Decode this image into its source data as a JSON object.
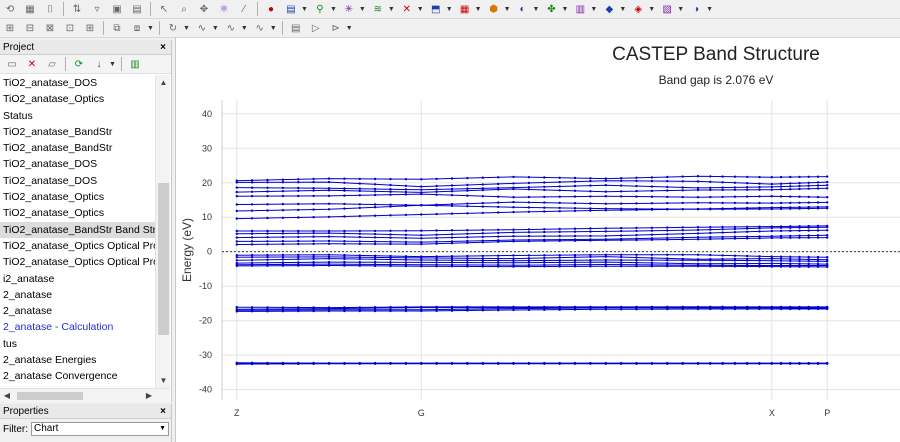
{
  "toolbar1": {
    "icons": [
      "refresh-icon",
      "grid-icon",
      "bracket-icon",
      "sort-icon",
      "funnel-icon",
      "window-icon",
      "window-icon-2",
      "select-icon",
      "zoom-icon",
      "move-icon",
      "atom-icon",
      "bond-icon",
      "record-icon",
      "castep-icon",
      "dmol-icon",
      "gulp-icon",
      "forcite-icon",
      "mesocite-icon",
      "amorphous-icon",
      "sorption-icon",
      "conformers-icon",
      "reflex-icon",
      "morphology-icon",
      "polymorph-icon",
      "dpd-icon",
      "blends-icon",
      "qsar-icon",
      "equilibria-icon"
    ]
  },
  "toolbar2": {
    "icons": [
      "grid-a-icon",
      "grid-b-icon",
      "grid-c-icon",
      "grid-d-icon",
      "grid-e-icon",
      "layer-icon",
      "format-icon",
      "rotate-icon",
      "curve-a-icon",
      "curve-b-icon",
      "curve-c-icon",
      "doc-icon",
      "play-icon",
      "step-icon"
    ]
  },
  "project": {
    "title": "Project",
    "close": "×",
    "items": [
      {
        "label": "TiO2_anatase_DOS",
        "style": "normal"
      },
      {
        "label": "TiO2_anatase_Optics",
        "style": "normal"
      },
      {
        "label": "Status",
        "style": "normal"
      },
      {
        "label": "TiO2_anatase_BandStr",
        "style": "normal"
      },
      {
        "label": "TiO2_anatase_BandStr",
        "style": "normal"
      },
      {
        "label": "TiO2_anatase_DOS",
        "style": "normal"
      },
      {
        "label": "TiO2_anatase_DOS",
        "style": "normal"
      },
      {
        "label": "TiO2_anatase_Optics",
        "style": "normal"
      },
      {
        "label": "TiO2_anatase_Optics",
        "style": "normal"
      },
      {
        "label": "TiO2_anatase_BandStr Band Stru",
        "style": "selected"
      },
      {
        "label": "TiO2_anatase_Optics Optical Pro",
        "style": "normal"
      },
      {
        "label": "TiO2_anatase_Optics Optical Pro",
        "style": "normal"
      },
      {
        "label": "i2_anatase",
        "style": "normal"
      },
      {
        "label": "2_anatase",
        "style": "normal"
      },
      {
        "label": "2_anatase",
        "style": "normal"
      },
      {
        "label": "2_anatase - Calculation",
        "style": "link"
      },
      {
        "label": "tus",
        "style": "normal"
      },
      {
        "label": "2_anatase Energies",
        "style": "normal"
      },
      {
        "label": "2_anatase Convergence",
        "style": "normal"
      }
    ]
  },
  "properties": {
    "title": "Properties",
    "close": "×",
    "filter_label": "Filter:",
    "filter_value": "Chart"
  },
  "colors": {
    "band": "#0000cc",
    "grid": "#e3e3e3",
    "fermi": "#000000"
  },
  "chart_data": {
    "type": "line",
    "title": "CASTEP Band Structure",
    "subtitle": "Band gap is 2.076 eV",
    "ylabel": "Energy (eV)",
    "xlabel": "",
    "ylim": [
      -43,
      44
    ],
    "yticks": [
      40,
      30,
      20,
      10,
      0,
      -10,
      -20,
      -30,
      -40
    ],
    "x": [
      0,
      0.5,
      1.0,
      1.5,
      2.0,
      2.5,
      2.9,
      3.2
    ],
    "xticks": [
      {
        "label": "Z",
        "x": 0
      },
      {
        "label": "G",
        "x": 1.0
      },
      {
        "label": "X",
        "x": 2.9
      },
      {
        "label": "P",
        "x": 3.2
      }
    ],
    "xlim": [
      -0.08,
      3.6
    ],
    "fermi_level": 0,
    "series": [
      {
        "values": [
          -32.2,
          -32.3,
          -32.3,
          -32.3,
          -32.3,
          -32.3,
          -32.3,
          -32.3
        ]
      },
      {
        "values": [
          -32.4,
          -32.4,
          -32.4,
          -32.4,
          -32.4,
          -32.4,
          -32.4,
          -32.4
        ]
      },
      {
        "values": [
          -32.6,
          -32.5,
          -32.5,
          -32.5,
          -32.5,
          -32.5,
          -32.5,
          -32.5
        ]
      },
      {
        "values": [
          -16.1,
          -16.2,
          -16.0,
          -16.0,
          -16.0,
          -16.0,
          -16.0,
          -16.0
        ]
      },
      {
        "values": [
          -16.7,
          -16.5,
          -16.2,
          -16.2,
          -16.1,
          -16.0,
          -16.1,
          -16.2
        ]
      },
      {
        "values": [
          -17.0,
          -16.8,
          -16.8,
          -16.5,
          -16.3,
          -16.3,
          -16.3,
          -16.4
        ]
      },
      {
        "values": [
          -17.3,
          -17.2,
          -17.2,
          -16.9,
          -16.7,
          -16.6,
          -16.6,
          -16.6
        ]
      },
      {
        "values": [
          -1.0,
          -0.9,
          -1.4,
          -1.1,
          -0.9,
          -0.9,
          -1.4,
          -1.6
        ]
      },
      {
        "values": [
          -1.6,
          -1.5,
          -1.8,
          -2.0,
          -1.4,
          -2.2,
          -2.0,
          -2.3
        ]
      },
      {
        "values": [
          -2.5,
          -2.0,
          -2.4,
          -2.6,
          -2.4,
          -2.5,
          -2.6,
          -2.8
        ]
      },
      {
        "values": [
          -3.3,
          -3.0,
          -3.1,
          -3.2,
          -3.0,
          -3.5,
          -3.4,
          -3.6
        ]
      },
      {
        "values": [
          -3.8,
          -3.6,
          -3.8,
          -3.9,
          -3.7,
          -3.9,
          -4.0,
          -4.0
        ]
      },
      {
        "values": [
          -4.1,
          -4.0,
          -4.2,
          -4.3,
          -4.2,
          -4.2,
          -4.3,
          -4.4
        ]
      },
      {
        "values": [
          2.1,
          2.3,
          2.2,
          3.0,
          3.3,
          3.6,
          4.0,
          4.1
        ]
      },
      {
        "values": [
          3.0,
          3.1,
          2.8,
          3.4,
          3.6,
          4.2,
          4.5,
          4.8
        ]
      },
      {
        "values": [
          4.1,
          4.4,
          3.9,
          4.5,
          4.6,
          5.3,
          6.0,
          6.2
        ]
      },
      {
        "values": [
          5.2,
          5.4,
          4.8,
          5.6,
          5.9,
          6.3,
          6.9,
          7.1
        ]
      },
      {
        "values": [
          6.0,
          6.0,
          6.1,
          6.4,
          6.8,
          7.1,
          7.3,
          7.5
        ]
      },
      {
        "values": [
          9.6,
          10.1,
          10.8,
          11.5,
          12.0,
          12.4,
          12.8,
          13.0
        ]
      },
      {
        "values": [
          11.8,
          12.3,
          13.5,
          12.9,
          12.5,
          12.3,
          12.4,
          12.6
        ]
      },
      {
        "values": [
          13.7,
          13.9,
          13.5,
          14.4,
          13.9,
          14.2,
          14.1,
          14.3
        ]
      },
      {
        "values": [
          16.1,
          16.2,
          16.7,
          15.8,
          16.1,
          15.8,
          16.1,
          15.8
        ]
      },
      {
        "values": [
          17.3,
          17.8,
          17.2,
          18.2,
          17.4,
          17.9,
          18.0,
          18.4
        ]
      },
      {
        "values": [
          18.6,
          18.4,
          18.0,
          18.6,
          19.3,
          18.5,
          18.8,
          19.3
        ]
      },
      {
        "values": [
          20.1,
          20.2,
          18.9,
          19.8,
          20.6,
          20.4,
          19.6,
          20.2
        ]
      },
      {
        "values": [
          20.6,
          21.2,
          21.0,
          21.7,
          21.2,
          21.9,
          21.6,
          21.8
        ]
      }
    ]
  }
}
